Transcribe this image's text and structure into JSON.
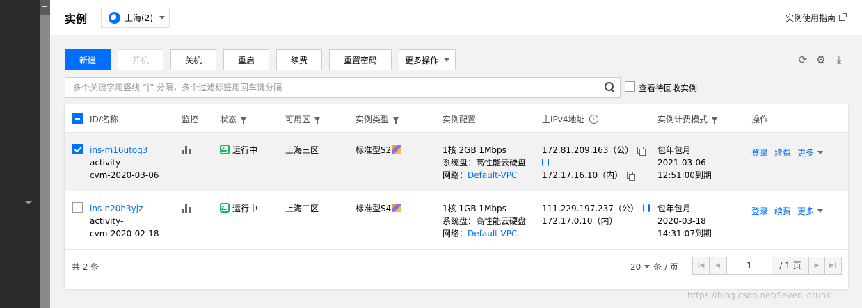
{
  "header": {
    "title": "实例",
    "region": "上海(2)",
    "guide_link": "实例使用指南"
  },
  "toolbar": {
    "new_label": "新建",
    "start_label": "开机",
    "shutdown_label": "关机",
    "restart_label": "重启",
    "renew_label": "续费",
    "reset_pwd_label": "重置密码",
    "more_label": "更多操作"
  },
  "search": {
    "placeholder": "多个关键字用竖线 “|” 分隔，多个过滤标签用回车键分隔",
    "recycle_label": "查看待回收实例"
  },
  "table": {
    "headers": {
      "id_name": "ID/名称",
      "monitor": "监控",
      "status": "状态",
      "zone": "可用区",
      "type": "实例类型",
      "config": "实例配置",
      "ipv4": "主IPv4地址",
      "billing": "实例计费模式",
      "ops": "操作"
    },
    "rows": [
      {
        "id": "ins-m16utoq3",
        "name_line1": "activity-",
        "name_line2": "cvm-2020-03-06",
        "status": "运行中",
        "zone": "上海三区",
        "type": "标准型S2",
        "config_line1": "1核 2GB 1Mbps",
        "config_line2": "系统盘：高性能云硬盘",
        "network_label": "网络：",
        "network_link": "Default-VPC",
        "ip_public": "172.81.209.163（公）",
        "ip_private": "172.17.16.10（内）",
        "billing_mode": "包年包月",
        "expire_date": "2021-03-06",
        "expire_time": "12:51:00到期",
        "selected": true
      },
      {
        "id": "ins-n20h3yjz",
        "name_line1": "activity-",
        "name_line2": "cvm-2020-02-18",
        "status": "运行中",
        "zone": "上海二区",
        "type": "标准型S4",
        "config_line1": "1核 1GB 1Mbps",
        "config_line2": "系统盘：高性能云硬盘",
        "network_label": "网络：",
        "network_link": "Default-VPC",
        "ip_public": "111.229.197.237（公）",
        "ip_private": "172.17.0.10（内）",
        "billing_mode": "包年包月",
        "expire_date": "2020-03-18",
        "expire_time": "14:31:07到期",
        "selected": false
      }
    ],
    "ops": {
      "login": "登录",
      "renew": "续费",
      "more": "更多"
    }
  },
  "footer": {
    "total": "共 2 条",
    "page_size": "20",
    "page_size_unit": "条 / 页",
    "current_page": "1",
    "total_pages": "/ 1 页"
  },
  "watermark": "https://blog.csdn.net/Seven_drunk",
  "colors": {
    "primary": "#006eff",
    "running": "#0abf5b"
  }
}
